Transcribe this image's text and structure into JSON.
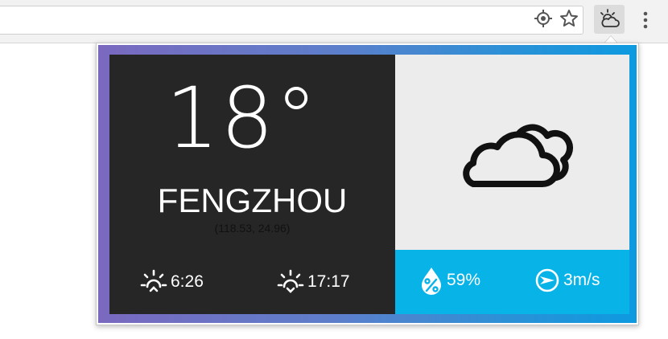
{
  "browser": {
    "toolbar_icons": [
      "location-icon",
      "bookmark-star-icon",
      "weather-extension-icon",
      "menu-kebab-icon"
    ]
  },
  "weather": {
    "temperature": "18°",
    "city": "FENGZHOU",
    "coordinates": "(118.53, 24.96)",
    "sunrise": "6:26",
    "sunset": "17:17",
    "humidity": "59%",
    "wind": "3m/s",
    "condition_icon": "cloudy-icon"
  },
  "colors": {
    "dark_panel": "#262626",
    "light_panel": "#ececec",
    "accent_blue": "#08b3e8",
    "frame_gradient_start": "#7a69bf",
    "frame_gradient_end": "#0d9ae0"
  }
}
